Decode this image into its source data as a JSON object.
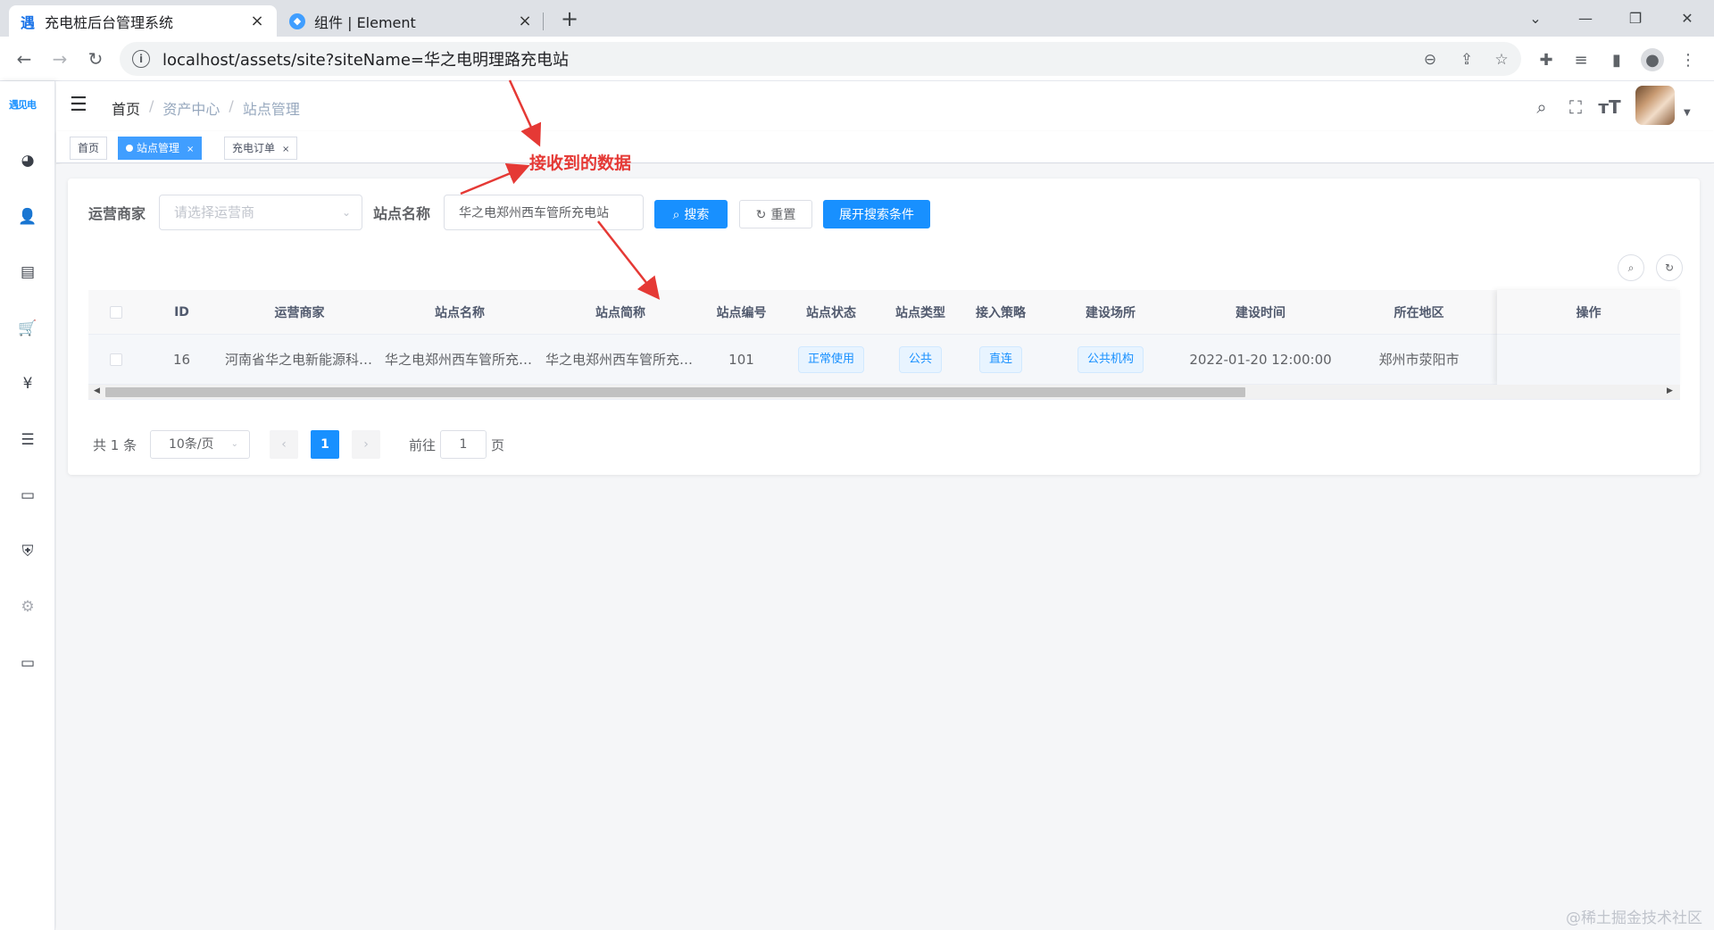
{
  "browser": {
    "tabs": [
      {
        "title": "充电桩后台管理系统",
        "favicon": "遇"
      },
      {
        "title": "组件 | Element"
      }
    ],
    "url": "localhost/assets/site?siteName=华之电明理路充电站"
  },
  "app": {
    "logo_text": "遇见电",
    "breadcrumb": {
      "home": "首页",
      "sep1": "/",
      "level1": "资产中心",
      "sep2": "/",
      "level2": "站点管理"
    },
    "tags": [
      {
        "label": "首页"
      },
      {
        "label": "站点管理",
        "close": "×"
      },
      {
        "label": "充电订单",
        "close": "×"
      }
    ]
  },
  "search": {
    "operator_label": "运营商家",
    "operator_placeholder": "请选择运营商",
    "site_label": "站点名称",
    "site_value": "华之电郑州西车管所充电站",
    "search_button": "搜索",
    "reset_button": "重置",
    "expand_button": "展开搜索条件"
  },
  "table": {
    "columns": [
      "ID",
      "运营商家",
      "站点名称",
      "站点简称",
      "站点编号",
      "站点状态",
      "站点类型",
      "接入策略",
      "建设场所",
      "建设时间",
      "所在地区",
      "操作"
    ],
    "rows": [
      {
        "id": "16",
        "operator": "河南省华之电新能源科技有限公司",
        "site_name": "华之电郑州西车管所充电站",
        "short_name": "华之电郑州西车管所充电站",
        "site_no": "101",
        "status": "正常使用",
        "type": "公共",
        "access": "直连",
        "place": "公共机构",
        "build_time": "2022-01-20 12:00:00",
        "region": "郑州市荥阳市"
      }
    ]
  },
  "pagination": {
    "total": "共 1 条",
    "page_size": "10条/页",
    "current": "1",
    "goto_prefix": "前往",
    "goto_value": "1",
    "goto_suffix": "页"
  },
  "annotation": {
    "text": "接收到的数据",
    "color": "#e53935"
  },
  "watermark": "@稀土掘金技术社区",
  "colors": {
    "primary": "#1890ff",
    "tag_bg": "#e8f4ff",
    "sidebar_bg": "#ffffff",
    "chrome_bg": "#dee1e6"
  }
}
